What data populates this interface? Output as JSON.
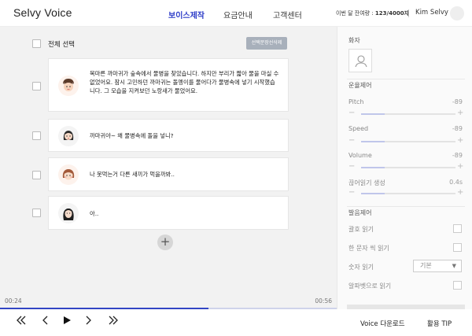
{
  "app": {
    "title": "Selvy Voice"
  },
  "nav": [
    {
      "label": "보이스제작",
      "active": true
    },
    {
      "label": "요금안내",
      "active": false
    },
    {
      "label": "고객센터",
      "active": false
    }
  ],
  "usage": {
    "prefix": "이번 달 잔여량 :",
    "value": "123/4000자"
  },
  "user": {
    "name": "Kim Selvy"
  },
  "list": {
    "select_all_label": "전체 선택",
    "delete_selected_label": "선택문장선삭제",
    "items": [
      {
        "text": "목마른 까마귀가 숲속에서 물병을 찾았습니다. 하지만 부리가 짧아 물을 마실 수 없었어요. 잠시 고민하던 까마귀는 돌멩이를 물어다가 물병속에 넣기 시작했습니다. 그 모습을 지켜보던 노랑새가 물었어요.",
        "avatar": "boy-avatar-icon"
      },
      {
        "text": "까마귀야~ 왜 물병속에 돌을 넣니?",
        "avatar": "woman-avatar-icon"
      },
      {
        "text": "나 못먹는거 다른 새끼가 먹을까봐..",
        "avatar": "girl-avatar-icon"
      },
      {
        "text": "아..",
        "avatar": "woman-longhair-avatar-icon"
      }
    ]
  },
  "player": {
    "current_time": "00:24",
    "total_time": "00:56",
    "progress": 0.62,
    "download_label": "Voice 다운로드",
    "tip_label": "활용 TIP"
  },
  "panel": {
    "speaker_label": "화자",
    "tone_label": "운율제어",
    "sliders": [
      {
        "label": "Pitch",
        "value": "-89",
        "level": 0.25
      },
      {
        "label": "Speed",
        "value": "-89",
        "level": 0.25
      },
      {
        "label": "Volume",
        "value": "-89",
        "level": 0.25
      }
    ],
    "pause_label": "끊어읽기 생성",
    "pause_value": "0.4s",
    "pause_level": 0.25,
    "pron_label": "발음제어",
    "pron_options": [
      {
        "label": "괄호 읽기"
      },
      {
        "label": "한 문자 씩 읽기"
      },
      {
        "label": "숫자 읽기"
      },
      {
        "label": "알파벳으로 읽기"
      }
    ],
    "number_select_value": "기본"
  },
  "colors": {
    "accent": "#3346c4",
    "progress_track": "#cfd3ea",
    "background": "#f2f2f2"
  }
}
